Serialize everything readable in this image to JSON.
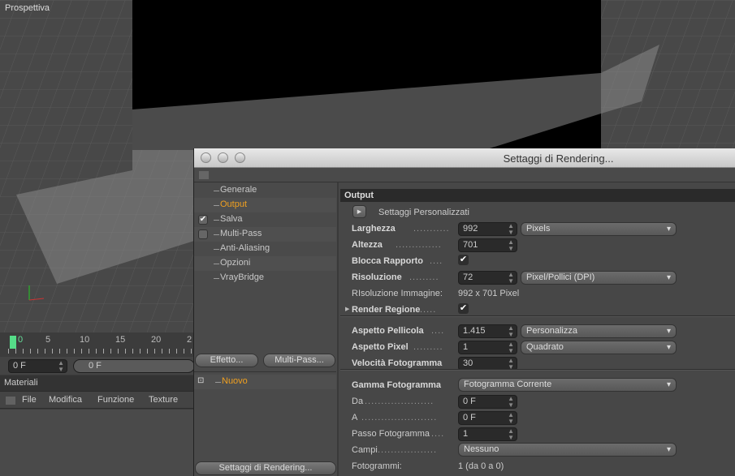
{
  "viewport": {
    "label": "Prospettiva"
  },
  "timeline": {
    "ticks": [
      "0",
      "5",
      "10",
      "15",
      "20",
      "2"
    ],
    "current_frame": "0 F",
    "slider_value": "0 F"
  },
  "materials": {
    "title": "Materiali",
    "menu": [
      "File",
      "Modifica",
      "Funzione",
      "Texture"
    ]
  },
  "dialog": {
    "title": "Settaggi di Rendering...",
    "nav": [
      {
        "label": "Generale",
        "checkbox": null
      },
      {
        "label": "Output",
        "checkbox": null,
        "selected": true
      },
      {
        "label": "Salva",
        "checkbox": "checked"
      },
      {
        "label": "Multi-Pass",
        "checkbox": "unchecked"
      },
      {
        "label": "Anti-Aliasing",
        "checkbox": null
      },
      {
        "label": "Opzioni",
        "checkbox": null
      },
      {
        "label": "VrayBridge",
        "checkbox": null
      }
    ],
    "effect_button": "Effetto...",
    "multipass_button": "Multi-Pass...",
    "preset_item": "Nuovo",
    "render_settings_button": "Settaggi di Rendering...",
    "output": {
      "header": "Output",
      "preset_label": "Settaggi  Personalizzati",
      "width_label": "Larghezza",
      "width": "992",
      "width_unit": "Pixels",
      "height_label": "Altezza",
      "height": "701",
      "lock_ratio_label": "Blocca Rapporto",
      "lock_ratio": true,
      "resolution_label": "Risoluzione",
      "resolution": "72",
      "resolution_unit": "Pixel/Pollici (DPI)",
      "image_resolution_label": "RIsoluzione Immagine:",
      "image_resolution": "992 x 701 Pixel",
      "render_region_label": "Render Regione",
      "render_region": true,
      "film_aspect_label": "Aspetto Pellicola",
      "film_aspect": "1.415",
      "film_aspect_preset": "Personalizza",
      "pixel_aspect_label": "Aspetto Pixel",
      "pixel_aspect": "1",
      "pixel_aspect_preset": "Quadrato",
      "frame_rate_label": "Velocità Fotogramma",
      "frame_rate": "30",
      "frame_range_label": "Gamma Fotogramma",
      "frame_range": "Fotogramma Corrente",
      "from_label": "Da",
      "from": "0 F",
      "to_label": "A",
      "to": "0 F",
      "frame_step_label": "Passo Fotogramma",
      "frame_step": "1",
      "fields_label": "Campi",
      "fields": "Nessuno",
      "frames_label": "Fotogrammi:",
      "frames": "1 (da 0 a 0)"
    }
  }
}
